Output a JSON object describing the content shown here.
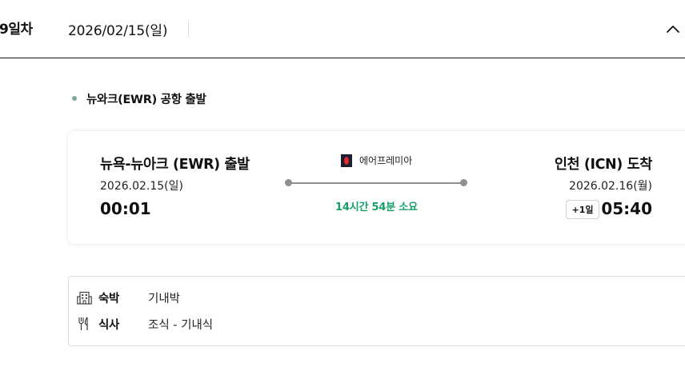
{
  "day": {
    "label": "9일차",
    "date": "2026/02/15(일)"
  },
  "section": {
    "title": "뉴와크(EWR) 공항 출발"
  },
  "flight": {
    "departure": {
      "title": "뉴욕-뉴아크 (EWR) 출발",
      "date": "2026.02.15(일)",
      "time": "00:01"
    },
    "arrival": {
      "title": "인천 (ICN) 도착",
      "date": "2026.02.16(월)",
      "time": "05:40",
      "next_day_badge": "+1일"
    },
    "airline": {
      "name": "에어프레미아",
      "logo_icon": "air-premia-logo-icon"
    },
    "duration": "14시간 54분 소요"
  },
  "info": {
    "lodging": {
      "label": "숙박",
      "value": "기내박",
      "icon": "hotel-building-icon"
    },
    "meal": {
      "label": "식사",
      "value": "조식 - 기내식",
      "icon": "fork-knife-icon"
    }
  },
  "colors": {
    "duration_green": "#15a06a",
    "section_dot": "#7fa89a",
    "route_line": "#8f8f8f",
    "header_border": "#111111"
  }
}
